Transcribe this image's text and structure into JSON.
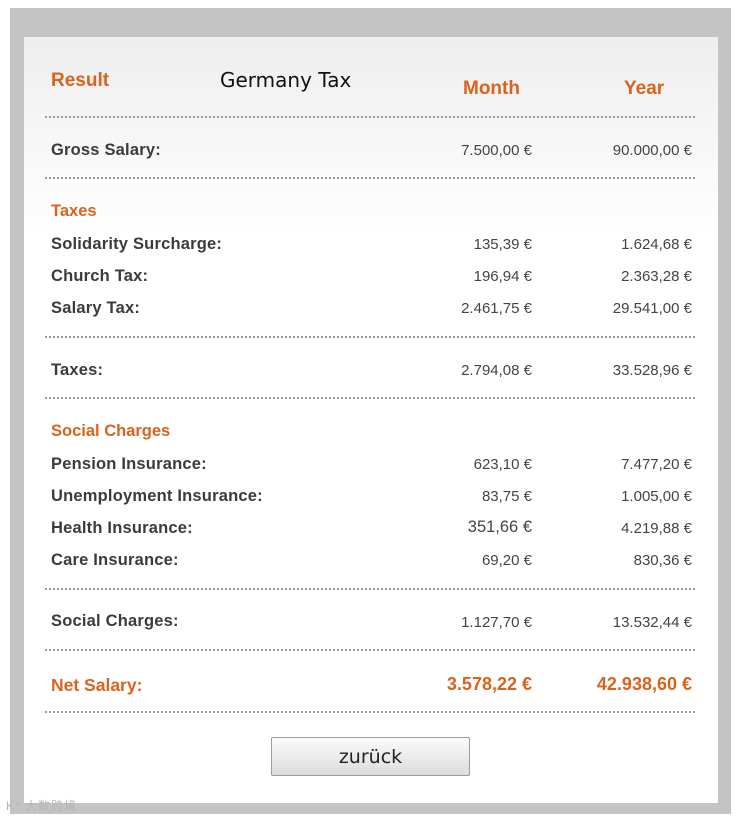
{
  "header": {
    "result": "Result",
    "title": "Germany Tax",
    "month": "Month",
    "year": "Year"
  },
  "gross": {
    "label": "Gross Salary:",
    "month": "7.500,00 €",
    "year": "90.000,00 €"
  },
  "taxes": {
    "section": "Taxes",
    "items": [
      {
        "label": "Solidarity Surcharge:",
        "month": "135,39 €",
        "year": "1.624,68 €"
      },
      {
        "label": "Church Tax:",
        "month": "196,94 €",
        "year": "2.363,28 €"
      },
      {
        "label": "Salary Tax:",
        "month": "2.461,75 €",
        "year": "29.541,00 €"
      }
    ],
    "total": {
      "label": "Taxes:",
      "month": "2.794,08 €",
      "year": "33.528,96 €"
    }
  },
  "social": {
    "section": "Social Charges",
    "items": [
      {
        "label": "Pension Insurance:",
        "month": "623,10 €",
        "year": "7.477,20 €"
      },
      {
        "label": "Unemployment Insurance:",
        "month": "83,75 €",
        "year": "1.005,00 €"
      },
      {
        "label": "Health Insurance:",
        "month": "351,66 €",
        "year": "4.219,88 €"
      },
      {
        "label": "Care Insurance:",
        "month": "69,20 €",
        "year": "830,36 €"
      }
    ],
    "total": {
      "label": "Social Charges:",
      "month": "1.127,70 €",
      "year": "13.532,44 €"
    }
  },
  "net": {
    "label": "Net Salary:",
    "month": "3.578,22 €",
    "year": "42.938,60 €"
  },
  "button": {
    "label": "zurück"
  },
  "watermark": "K° 大数跨境",
  "colors": {
    "accent": "#d9631c",
    "frame": "#c4c4c4"
  }
}
